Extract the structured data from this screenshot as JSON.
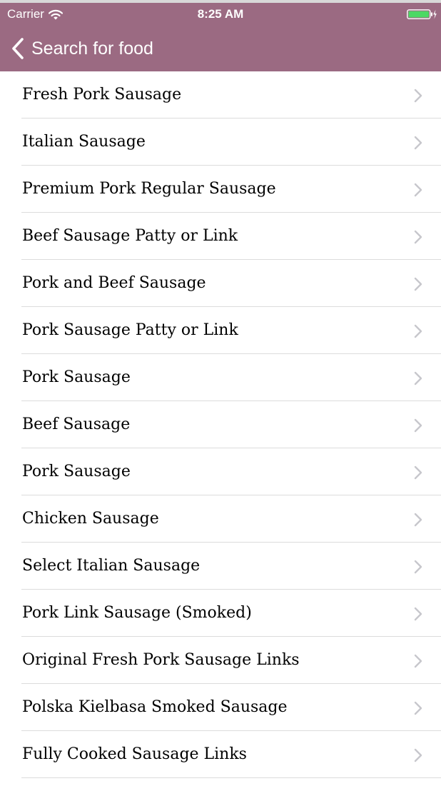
{
  "status_bar": {
    "carrier": "Carrier",
    "time": "8:25 AM"
  },
  "nav": {
    "back_label": "Search for food"
  },
  "colors": {
    "nav_background": "#9b6a82",
    "battery_fill": "#4cd964",
    "chevron": "#c7c7cc"
  },
  "icons": {
    "wifi": "wifi-icon",
    "battery": "battery-charging-icon",
    "back": "chevron-left-icon",
    "row_disclosure": "chevron-right-icon"
  },
  "items": [
    {
      "label": "Fresh Pork Sausage"
    },
    {
      "label": "Italian Sausage"
    },
    {
      "label": "Premium Pork Regular Sausage"
    },
    {
      "label": "Beef Sausage Patty or Link"
    },
    {
      "label": "Pork and Beef Sausage"
    },
    {
      "label": "Pork Sausage Patty or Link"
    },
    {
      "label": "Pork Sausage"
    },
    {
      "label": "Beef Sausage"
    },
    {
      "label": "Pork Sausage"
    },
    {
      "label": "Chicken Sausage"
    },
    {
      "label": "Select Italian Sausage"
    },
    {
      "label": "Pork Link Sausage (Smoked)"
    },
    {
      "label": "Original Fresh Pork Sausage Links"
    },
    {
      "label": "Polska Kielbasa Smoked Sausage"
    },
    {
      "label": "Fully Cooked Sausage Links"
    }
  ]
}
